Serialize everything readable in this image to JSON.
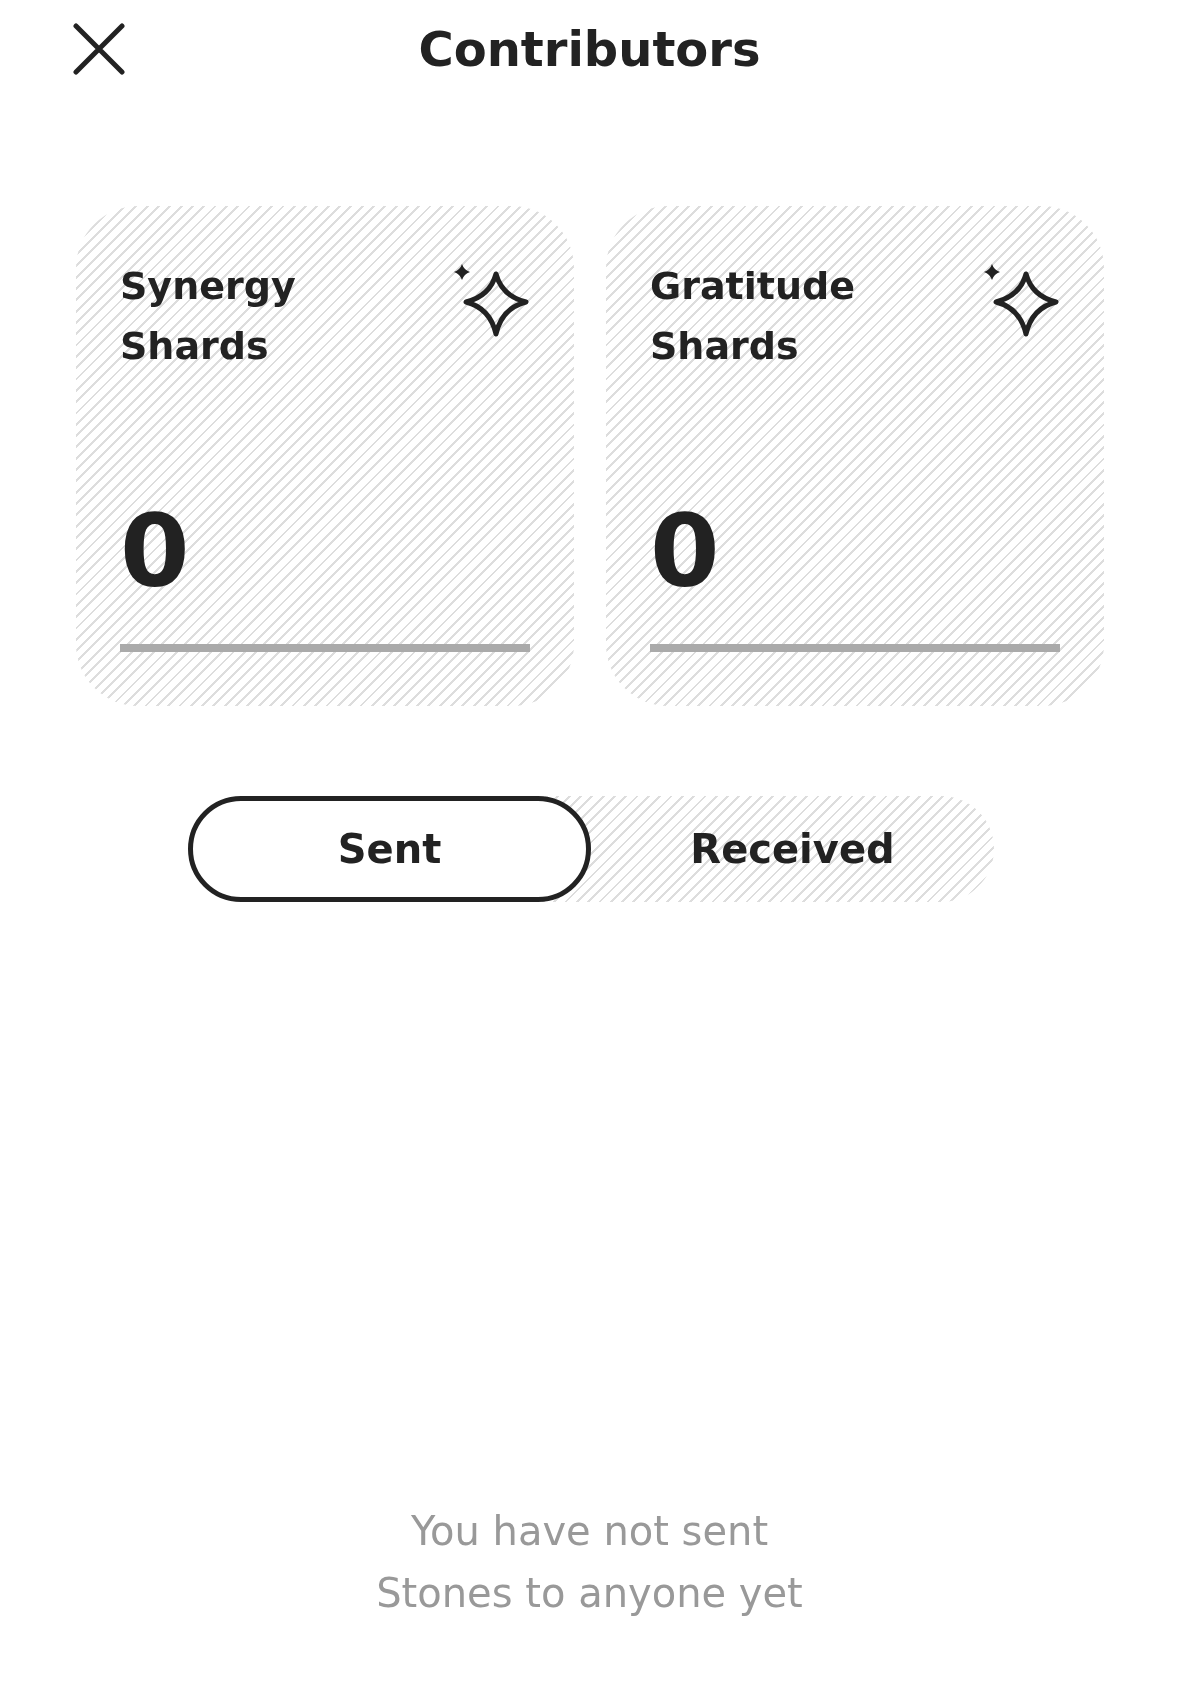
{
  "header": {
    "title": "Contributors"
  },
  "cards": [
    {
      "title": "Synergy Shards",
      "value": "0",
      "level": 0
    },
    {
      "title": "Gratitude Shards",
      "value": "0",
      "level": 0
    }
  ],
  "tabs": [
    {
      "label": "Sent",
      "selected": true
    },
    {
      "label": "Received",
      "selected": false
    }
  ],
  "empty_state": {
    "message": "You have not sent Stones to anyone yet"
  }
}
